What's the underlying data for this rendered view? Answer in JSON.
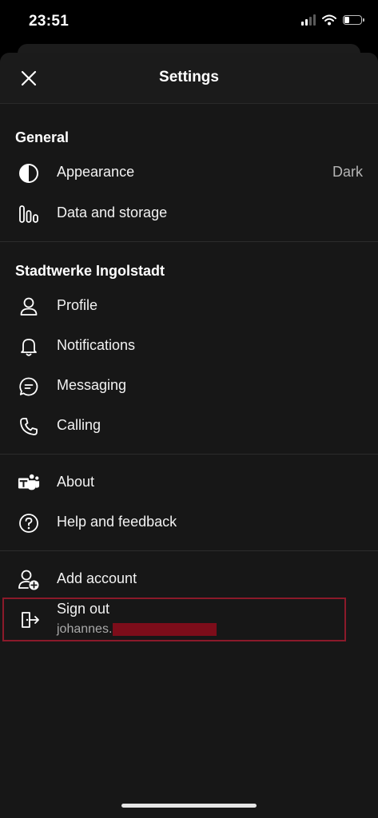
{
  "status_bar": {
    "time": "23:51",
    "icons": [
      "cellular-signal-icon",
      "wifi-icon",
      "battery-icon"
    ]
  },
  "header": {
    "title": "Settings",
    "close_icon": "close-icon"
  },
  "sections": {
    "general": {
      "heading": "General",
      "items": [
        {
          "label": "Appearance",
          "value": "Dark",
          "icon": "appearance-icon"
        },
        {
          "label": "Data and storage",
          "icon": "data-storage-icon"
        }
      ]
    },
    "organization": {
      "heading": "Stadtwerke Ingolstadt",
      "items": [
        {
          "label": "Profile",
          "icon": "profile-icon"
        },
        {
          "label": "Notifications",
          "icon": "bell-icon"
        },
        {
          "label": "Messaging",
          "icon": "chat-bubble-icon"
        },
        {
          "label": "Calling",
          "icon": "phone-icon"
        }
      ]
    },
    "support": {
      "items": [
        {
          "label": "About",
          "icon": "teams-logo-icon"
        },
        {
          "label": "Help and feedback",
          "icon": "question-icon"
        }
      ]
    },
    "account": {
      "add_account_label": "Add account",
      "sign_out_label": "Sign out",
      "account_name": "johannes."
    }
  },
  "colors": {
    "background": "#000000",
    "sheet": "#171717",
    "highlight_border": "#8b1a2a",
    "redaction": "#7d0d1a"
  }
}
